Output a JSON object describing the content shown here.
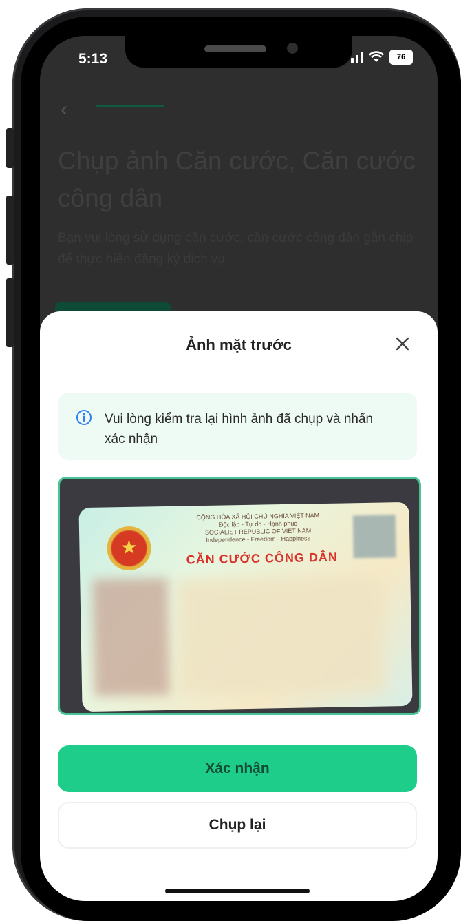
{
  "status_bar": {
    "time": "5:13",
    "battery": "76"
  },
  "background_page": {
    "title": "Chụp ảnh Căn cước, Căn cước công dân",
    "description": "Bạn vui lòng sử dụng căn cước, căn cước công dân gắn chip để thực hiện đăng ký dịch vụ."
  },
  "sheet": {
    "title": "Ảnh mặt trước",
    "info_text": "Vui lòng kiểm tra lại hình ảnh đã chụp và nhấn xác nhận",
    "card": {
      "header_line1": "CỘNG HÒA XÃ HỘI CHỦ NGHĨA VIỆT NAM",
      "header_line2": "Độc lập - Tự do - Hạnh phúc",
      "header_line3": "SOCIALIST REPUBLIC OF VIET NAM",
      "header_line4": "Independence - Freedom - Happiness",
      "title": "CĂN CƯỚC CÔNG DÂN"
    },
    "confirm_label": "Xác nhận",
    "retake_label": "Chụp lại"
  },
  "colors": {
    "accent": "#1fcd8a",
    "info_bg": "#eefaf4",
    "info_icon": "#2f80ed"
  }
}
